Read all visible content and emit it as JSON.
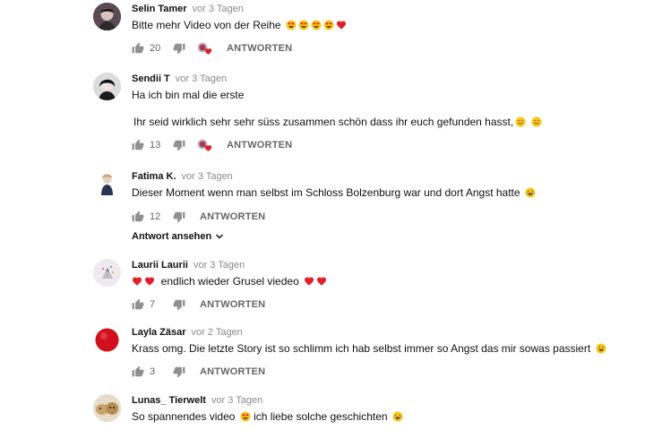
{
  "reply_label": "ANTWORTEN",
  "comments": [
    {
      "author": "Selin Tamer",
      "time": "vor 3 Tagen",
      "text": "Bitte mehr Video von der Reihe",
      "likes": "20",
      "creator_heart": true
    },
    {
      "author": "Sendii T",
      "time": "vor 3 Tagen",
      "text": "Ha ich bin mal die erste",
      "text2": "Ihr seid wirklich sehr sehr süss zusammen schön dass ihr euch gefunden hasst,",
      "likes": "13",
      "creator_heart": true
    },
    {
      "author": "Fatima K.",
      "time": "vor 3 Tagen",
      "text": "Dieser Moment wenn man selbst im Schloss Bolzenburg war und dort Angst hatte",
      "likes": "12",
      "creator_heart": false,
      "view_replies": "Antwort ansehen"
    },
    {
      "author": "Laurii Laurii",
      "time": "vor 3 Tagen",
      "text": "endlich wieder Grusel viedeo",
      "likes": "7",
      "creator_heart": false
    },
    {
      "author": "Layla Zäsar",
      "time": "vor 2 Tagen",
      "text": "Krass omg. Die letzte Story ist so schlimm ich hab selbst immer so Angst das mir sowas passiert",
      "likes": "3",
      "creator_heart": false
    },
    {
      "author": "Lunas_ Tierwelt",
      "time": "vor 3 Tagen",
      "text1": "So spannendes video",
      "text2b": "ich liebe solche geschichten",
      "creator_heart": false
    }
  ],
  "colors": {
    "author": "#111111",
    "time": "#8a8a8a",
    "action": "#666666",
    "heart": "#e0202a",
    "emoji_face": "#f5c518"
  }
}
